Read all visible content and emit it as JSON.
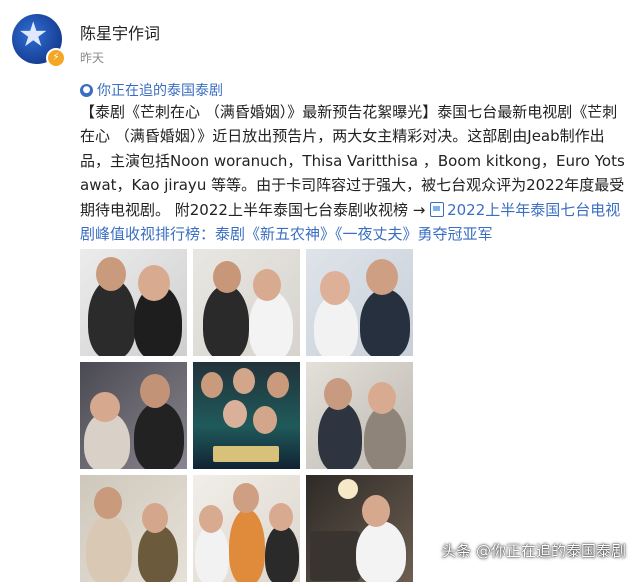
{
  "header": {
    "username": "陈星宇作词",
    "time": "昨天"
  },
  "topic": {
    "label": "你正在追的泰国泰剧"
  },
  "post": {
    "text": "【泰剧《芒刺在心 （满昏婚姻）》最新预告花絮曝光】泰国七台最新电视剧《芒刺在心 （满昏婚姻）》近日放出预告片，两大女主精彩对决。这部剧由Jeab制作出品，主演包括Noon woranuch，Thisa Varitthisa ，Boom kitkong，Euro Yotsawat，Kao jirayu 等等。由于卡司阵容过于强大，被七台观众评为2022年度最受期待电视剧。 附2022上半年泰国七台泰剧收视榜 → ",
    "link_text": "2022上半年泰国七台电视剧峰值收视排行榜：泰剧《新五农神》《一夜丈夫》勇夺冠亚军"
  },
  "photos": [
    {
      "name": "photo-1"
    },
    {
      "name": "photo-2"
    },
    {
      "name": "photo-3"
    },
    {
      "name": "photo-4"
    },
    {
      "name": "photo-5"
    },
    {
      "name": "photo-6"
    },
    {
      "name": "photo-7"
    },
    {
      "name": "photo-8"
    },
    {
      "name": "photo-9"
    }
  ],
  "watermark": "头条 @你正在追的泰国泰剧",
  "colors": {
    "link": "#3a6ec2",
    "muted": "#8a8a8a",
    "text": "#222222"
  }
}
